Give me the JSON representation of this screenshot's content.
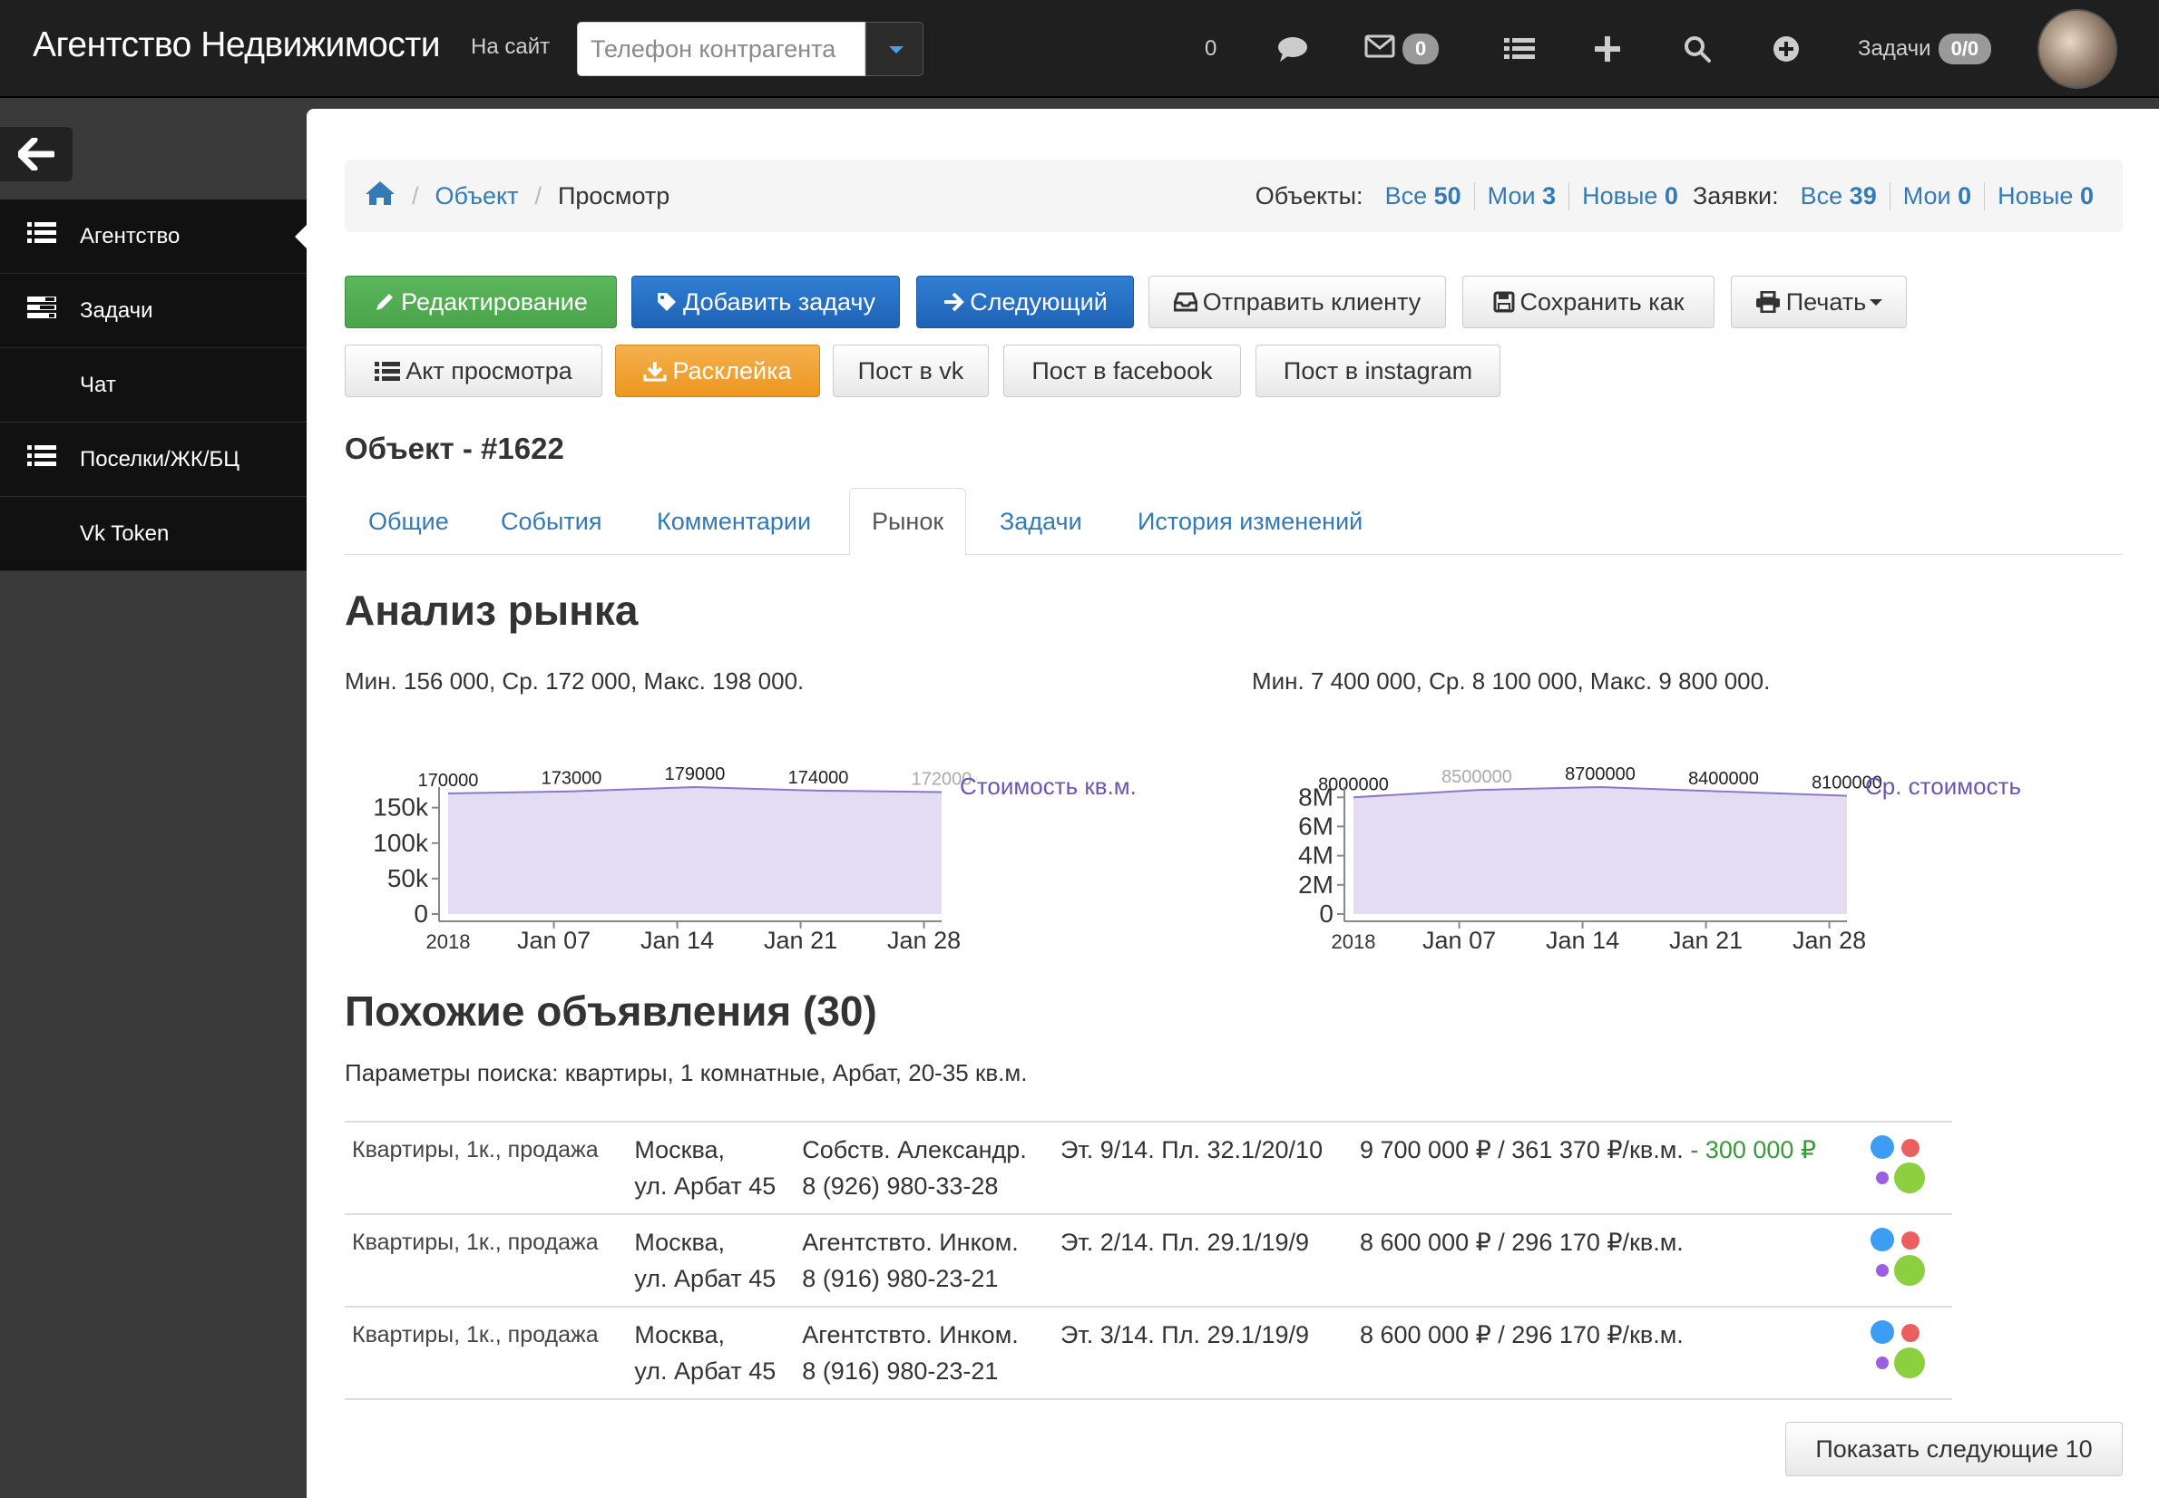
{
  "navbar": {
    "brand": "Агентство Недвижимости",
    "to_site": "На сайт",
    "phone_placeholder": "Телефон контрагента",
    "calls_count": "0",
    "mail_badge": "0",
    "tasks_label": "Задачи",
    "tasks_badge": "0/0"
  },
  "sidebar": {
    "items": [
      {
        "label": "Агентство",
        "icon": "list-icon"
      },
      {
        "label": "Задачи",
        "icon": "tasks-icon"
      },
      {
        "label": "Чат",
        "icon": ""
      },
      {
        "label": "Поселки/ЖК/БЦ",
        "icon": "list-icon"
      },
      {
        "label": "Vk Token",
        "icon": ""
      }
    ]
  },
  "breadcrumb": {
    "object": "Объект",
    "view": "Просмотр",
    "objects_label": "Объекты:",
    "requests_label": "Заявки:",
    "objects": [
      {
        "label": "Все",
        "count": "50"
      },
      {
        "label": "Мои",
        "count": "3"
      },
      {
        "label": "Новые",
        "count": "0"
      }
    ],
    "requests": [
      {
        "label": "Все",
        "count": "39"
      },
      {
        "label": "Мои",
        "count": "0"
      },
      {
        "label": "Новые",
        "count": "0"
      }
    ]
  },
  "actions": {
    "edit": "Редактирование",
    "add_task": "Добавить задачу",
    "next": "Следующий",
    "send_client": "Отправить клиенту",
    "save_as": "Сохранить как",
    "print": "Печать",
    "act": "Акт просмотра",
    "posting": "Расклейка",
    "post_vk": "Пост в vk",
    "post_facebook": "Пост в facebook",
    "post_instagram": "Пост в instagram"
  },
  "object_title": "Объект - #1622",
  "tabs": [
    "Общие",
    "События",
    "Комментарии",
    "Рынок",
    "Задачи",
    "История изменений"
  ],
  "market": {
    "title": "Анализ рынка",
    "left_stats": "Мин. 156 000, Ср. 172 000, Макс. 198 000.",
    "right_stats": "Мин. 7 400 000, Ср. 8 100 000, Макс. 9 800 000."
  },
  "chart_data": [
    {
      "type": "area",
      "series": [
        {
          "name": "Стоимость кв.м.",
          "color": "#6a55b8",
          "x": [
            "2018-01-01",
            "2018-01-08",
            "2018-01-15",
            "2018-01-22",
            "2018-01-29"
          ],
          "values": [
            170000,
            173000,
            179000,
            174000,
            172000
          ]
        }
      ],
      "point_labels": [
        "170000",
        "173000",
        "179000",
        "174000",
        "172000"
      ],
      "x_tick_labels": [
        "2018",
        "Jan 07",
        "Jan 14",
        "Jan 21",
        "Jan 28"
      ],
      "x_ticks": [
        "2018-01-01",
        "2018-01-07",
        "2018-01-14",
        "2018-01-21",
        "2018-01-28"
      ],
      "y_tick_labels": [
        "0",
        "50k",
        "100k",
        "150k"
      ],
      "y_ticks": [
        0,
        50000,
        100000,
        150000
      ],
      "ylim": [
        0,
        179000
      ],
      "legend": "right"
    },
    {
      "type": "area",
      "series": [
        {
          "name": "Ср. стоимость",
          "color": "#6a55b8",
          "x": [
            "2018-01-01",
            "2018-01-08",
            "2018-01-15",
            "2018-01-22",
            "2018-01-29"
          ],
          "values": [
            8000000,
            8500000,
            8700000,
            8400000,
            8100000
          ]
        }
      ],
      "point_labels": [
        "8000000",
        "8500000",
        "8700000",
        "8400000",
        "8100000"
      ],
      "x_tick_labels": [
        "2018",
        "Jan 07",
        "Jan 14",
        "Jan 21",
        "Jan 28"
      ],
      "x_ticks": [
        "2018-01-01",
        "2018-01-07",
        "2018-01-14",
        "2018-01-21",
        "2018-01-28"
      ],
      "y_tick_labels": [
        "0",
        "2M",
        "4M",
        "6M",
        "8M"
      ],
      "y_ticks": [
        0,
        2000000,
        4000000,
        6000000,
        8000000
      ],
      "ylim": [
        0,
        8700000
      ],
      "legend": "right"
    }
  ],
  "similar": {
    "title": "Похожие объявления (30)",
    "params": "Параметры поиска: квартиры, 1 комнатные, Арбат, 20-35 кв.м.",
    "rows": [
      {
        "category": "Квартиры, 1к., продажа",
        "city": "Москва,",
        "street": "ул. Арбат 45",
        "contact": "Собств. Александр.",
        "phone": "8 (926) 980-33-28",
        "params": "Эт. 9/14. Пл. 32.1/20/10",
        "price": "9 700 000 ₽ / 361 370 ₽/кв.м.",
        "discount": "- 300 000 ₽"
      },
      {
        "category": "Квартиры, 1к., продажа",
        "city": "Москва,",
        "street": "ул. Арбат 45",
        "contact": "Агентствто. Инком.",
        "phone": "8 (916) 980-23-21",
        "params": "Эт. 2/14. Пл. 29.1/19/9",
        "price": "8 600 000 ₽ / 296 170 ₽/кв.м.",
        "discount": ""
      },
      {
        "category": "Квартиры, 1к., продажа",
        "city": "Москва,",
        "street": "ул. Арбат 45",
        "contact": "Агентствто. Инком.",
        "phone": "8 (916) 980-23-21",
        "params": "Эт. 3/14. Пл. 29.1/19/9",
        "price": "8 600 000 ₽ / 296 170 ₽/кв.м.",
        "discount": ""
      }
    ],
    "more": "Показать следующие 10"
  },
  "colors": {
    "link": "#337ab7",
    "green": "#5cb85c",
    "blue": "#1f62b5",
    "orange": "#ec971f",
    "area_fill": "#e3dcf3",
    "area_line": "#8a78c8",
    "dot_blue": "#3d9df5",
    "dot_red": "#ec5f5f",
    "dot_purple": "#9b5fe0",
    "dot_green": "#8ccf3f"
  }
}
